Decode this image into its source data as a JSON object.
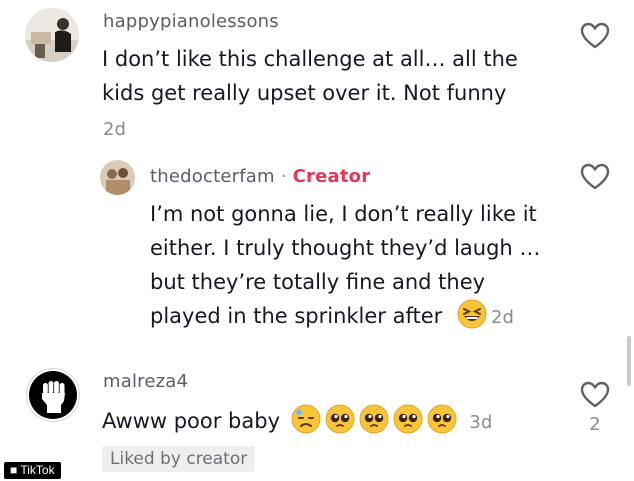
{
  "comments": [
    {
      "username": "happypianolessons",
      "text_lines": [
        "I don’t like this challenge at all… all the",
        "kids get really upset over it. Not funny"
      ],
      "time": "2d"
    }
  ],
  "reply": {
    "username": "thedocterfam",
    "separator": "·",
    "badge": "Creator",
    "text_lines": [
      "I’m not gonna lie, I don’t really like it",
      "either. I truly thought they’d laugh …",
      "but they’re totally fine and they",
      "played in the sprinkler after"
    ],
    "time": "2d"
  },
  "comment2": {
    "username": "malreza4",
    "text": "Awww poor baby",
    "time": "3d",
    "like_count": "2",
    "liked_by": "Liked by creator"
  },
  "watermark": "■ TikTok",
  "icons": {
    "like": "heart-outline-icon",
    "grin": "grinning-squinting-emoji",
    "sweat": "downcast-sweat-emoji",
    "pleading": "pleading-face-emoji"
  },
  "colors": {
    "creator_badge": "#e0395a",
    "meta": "#8a8b91"
  }
}
